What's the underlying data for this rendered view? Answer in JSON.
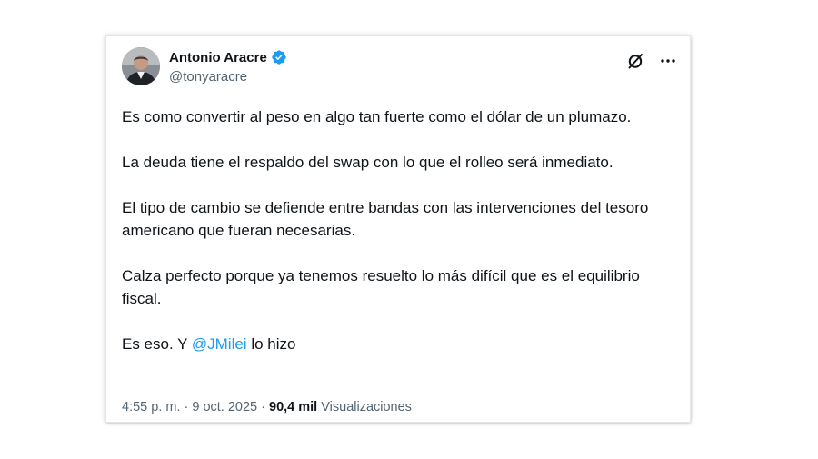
{
  "author": {
    "display_name": "Antonio Aracre",
    "handle": "@tonyaracre",
    "verified": true
  },
  "icons": {
    "avatar": "avatar-photo",
    "verified": "verified-badge-icon",
    "grok": "grok-icon",
    "more": "more-icon"
  },
  "colors": {
    "accent": "#1d9bf0",
    "text": "#0f1419",
    "secondary": "#536471"
  },
  "tweet": {
    "p1": "Es como convertir al peso en algo tan fuerte como el dólar de un plumazo.",
    "p2": "La deuda tiene el respaldo del swap con lo que el rolleo será inmediato.",
    "p3": "El tipo de cambio se defiende entre bandas con las intervenciones del tesoro americano que fueran necesarias.",
    "p4": "Calza perfecto porque ya tenemos resuelto lo más difícil que es el equilibrio fiscal.",
    "p5_before": "Es eso. Y ",
    "p5_mention": "@JMilei",
    "p5_after": " lo hizo"
  },
  "meta": {
    "time": "4:55 p. m.",
    "sep1": " · ",
    "date": "9 oct. 2025",
    "sep2": " · ",
    "views_count": "90,4 mil",
    "views_label": " Visualizaciones"
  }
}
